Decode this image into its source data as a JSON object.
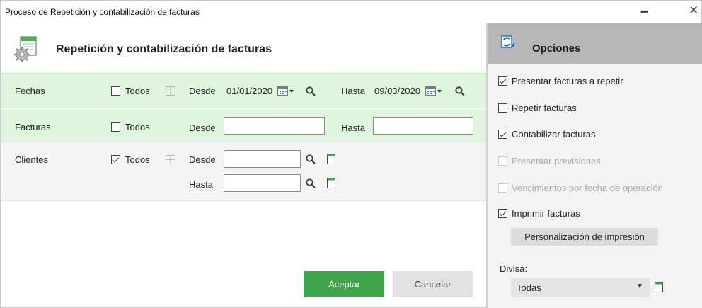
{
  "window": {
    "title": "Proceso de Repetición y contabilización de facturas",
    "menu_dots": "▪▪▪",
    "close_glyph": "✕"
  },
  "header": {
    "title": "Repetición y contabilización de facturas",
    "icon": "gear-icon"
  },
  "filters": {
    "fechas": {
      "label": "Fechas",
      "todos_label": "Todos",
      "todos_checked": false,
      "desde_label": "Desde",
      "desde_value": "01/01/2020",
      "hasta_label": "Hasta",
      "hasta_value": "09/03/2020"
    },
    "facturas": {
      "label": "Facturas",
      "todos_label": "Todos",
      "todos_checked": false,
      "desde_label": "Desde",
      "desde_value": "",
      "hasta_label": "Hasta",
      "hasta_value": ""
    },
    "clientes": {
      "label": "Clientes",
      "todos_label": "Todos",
      "todos_checked": true,
      "desde_label": "Desde",
      "desde_value": "",
      "hasta_label": "Hasta",
      "hasta_value": ""
    }
  },
  "actions": {
    "accept_label": "Aceptar",
    "cancel_label": "Cancelar"
  },
  "options": {
    "title": "Opciones",
    "items": [
      {
        "label": "Presentar facturas a repetir",
        "checked": true,
        "enabled": true
      },
      {
        "label": "Repetir facturas",
        "checked": false,
        "enabled": true
      },
      {
        "label": "Contabilizar facturas",
        "checked": true,
        "enabled": true
      },
      {
        "label": "Presentar previsiones",
        "checked": false,
        "enabled": false
      },
      {
        "label": "Vencimientos por fecha de operación",
        "checked": false,
        "enabled": false
      },
      {
        "label": "Imprimir facturas",
        "checked": true,
        "enabled": true
      }
    ],
    "print_button_label": "Personalización de impresión",
    "divisa_label": "Divisa:",
    "divisa_value": "Todas",
    "divisa_caret": "▼"
  },
  "colors": {
    "accent_green": "#3fa54a",
    "row_green": "#dff5dd",
    "options_header": "#b7b7b7"
  }
}
